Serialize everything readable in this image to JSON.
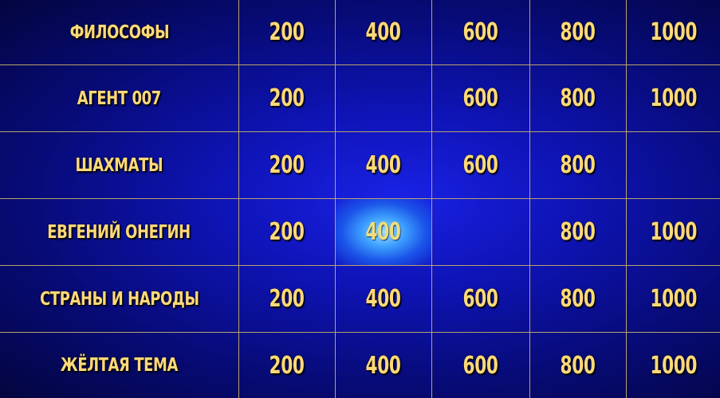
{
  "board": {
    "rows": [
      {
        "category": "ФИЛОСОФЫ",
        "prices": [
          "200",
          "400",
          "600",
          "800",
          "1000"
        ]
      },
      {
        "category": "АГЕНТ 007",
        "prices": [
          "200",
          "",
          "600",
          "800",
          "1000"
        ]
      },
      {
        "category": "ШАХМАТЫ",
        "prices": [
          "200",
          "400",
          "600",
          "800",
          ""
        ]
      },
      {
        "category": "ЕВГЕНИЙ ОНЕГИН",
        "prices": [
          "200",
          "400",
          "",
          "800",
          "1000"
        ]
      },
      {
        "category": "СТРАНЫ И НАРОДЫ",
        "prices": [
          "200",
          "400",
          "600",
          "800",
          "1000"
        ]
      },
      {
        "category": "ЖЁЛТАЯ ТЕМА",
        "prices": [
          "200",
          "400",
          "600",
          "800",
          "1000"
        ]
      }
    ],
    "highlighted": {
      "row": 3,
      "col": 1
    },
    "colors": {
      "background": "#0f14b8",
      "text": "#ffd978",
      "gridline": "#b9a46a",
      "highlight": "#9fe0ff"
    }
  }
}
